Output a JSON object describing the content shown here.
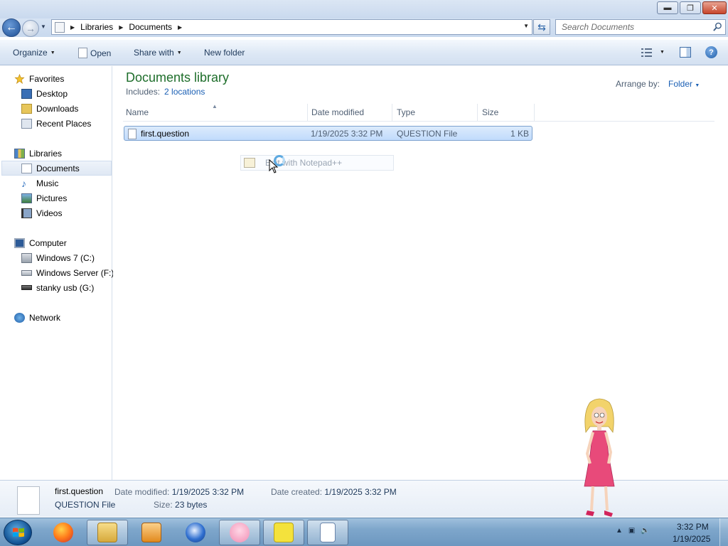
{
  "window": {
    "minimize_glyph": "▬",
    "maximize_glyph": "❐",
    "close_glyph": "✕"
  },
  "address": {
    "crumbs": [
      "Libraries",
      "Documents"
    ],
    "search_placeholder": "Search Documents"
  },
  "commandbar": {
    "organize": "Organize",
    "open": "Open",
    "share_with": "Share with",
    "new_folder": "New folder"
  },
  "navpane": {
    "favorites": "Favorites",
    "desktop": "Desktop",
    "downloads": "Downloads",
    "recent_places": "Recent Places",
    "libraries": "Libraries",
    "documents": "Documents",
    "music": "Music",
    "pictures": "Pictures",
    "videos": "Videos",
    "computer": "Computer",
    "drive_c": "Windows 7 (C:)",
    "drive_f": "Windows Server (F:)",
    "drive_g": "stanky usb (G:)",
    "network": "Network"
  },
  "library": {
    "title": "Documents library",
    "includes_label": "Includes:",
    "includes_link": "2 locations",
    "arrange_label": "Arrange by:",
    "arrange_value": "Folder"
  },
  "columns": {
    "name": "Name",
    "date_modified": "Date modified",
    "type": "Type",
    "size": "Size"
  },
  "files": [
    {
      "name": "first.question",
      "date_modified": "1/19/2025 3:32 PM",
      "type": "QUESTION File",
      "size": "1 KB"
    }
  ],
  "drag_ghost": {
    "text": "Edit with Notepad++"
  },
  "details": {
    "name": "first.question",
    "type": "QUESTION File",
    "date_modified_label": "Date modified:",
    "date_modified": "1/19/2025 3:32 PM",
    "date_created_label": "Date created:",
    "date_created": "1/19/2025 3:32 PM",
    "size_label": "Size:",
    "size": "23 bytes"
  },
  "taskbar": {
    "time": "3:32 PM",
    "date": "1/19/2025",
    "apps": [
      "firefox-icon",
      "explorer-icon",
      "media-player-icon",
      "thunderbird-icon",
      "piglet-icon",
      "spongebob-icon",
      "notepad-icon"
    ]
  },
  "colors": {
    "library_title": "#1e6e2b",
    "link": "#1a5fb4",
    "selection_bg": "#c1dbfc"
  }
}
